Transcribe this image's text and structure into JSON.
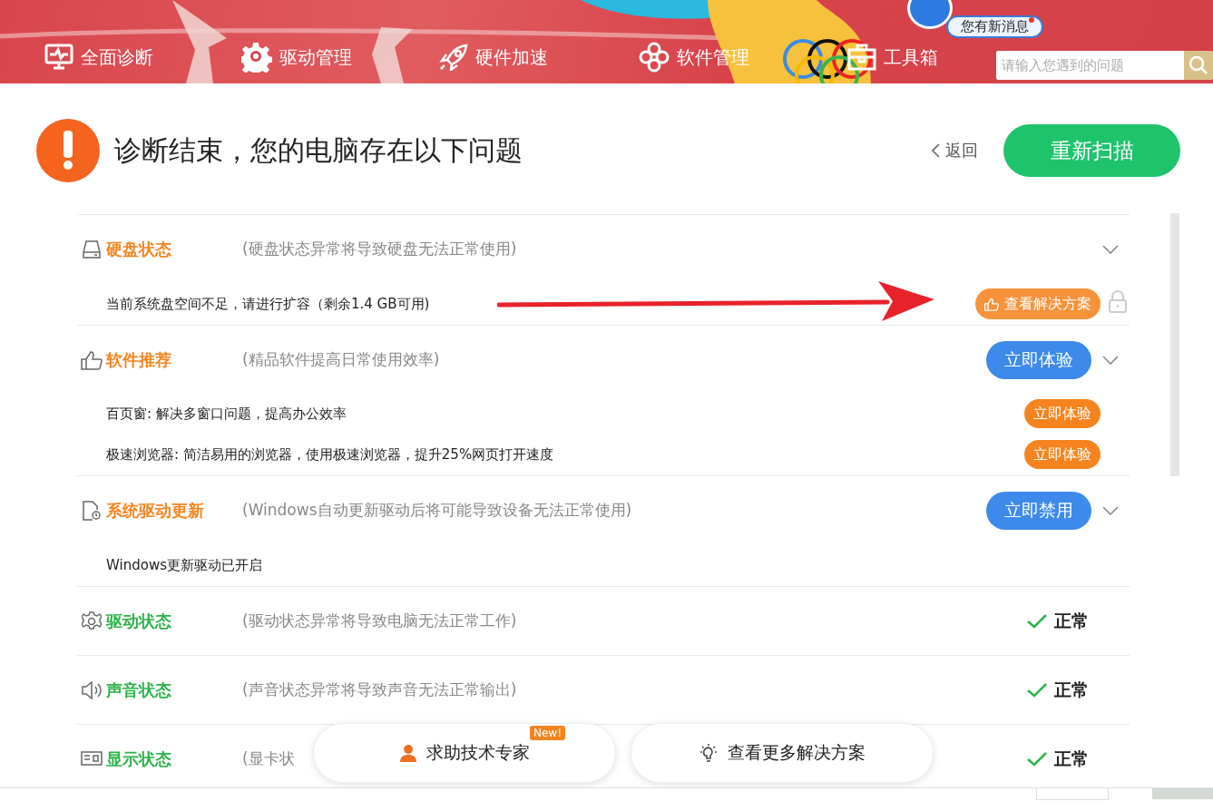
{
  "nav": [
    {
      "label": "全面诊断"
    },
    {
      "label": "驱动管理"
    },
    {
      "label": "硬件加速"
    },
    {
      "label": "软件管理"
    },
    {
      "label": "工具箱"
    }
  ],
  "notification": {
    "text": "您有新消息",
    "unread": true
  },
  "search": {
    "placeholder": "请输入您遇到的问题"
  },
  "result": {
    "title": "诊断结束，您的电脑存在以下问题",
    "back": "返回",
    "rescan": "重新扫描"
  },
  "sections": [
    {
      "kind": "issue",
      "title": "硬盘状态",
      "hint": "(硬盘状态异常将导致硬盘无法正常使用)",
      "expanded": true,
      "details": [
        {
          "kind": "solution",
          "text": "当前系统盘空间不足，请进行扩容（剩余1.4 GB可用)",
          "action": "查看解决方案",
          "locked": true
        }
      ]
    },
    {
      "kind": "issue",
      "title": "软件推荐",
      "hint": "(精品软件提高日常使用效率)",
      "action": "立即体验",
      "expanded": true,
      "details": [
        {
          "kind": "try",
          "text": "百页窗: 解决多窗口问题，提高办公效率",
          "action": "立即体验"
        },
        {
          "kind": "try",
          "text": "极速浏览器:  简洁易用的浏览器，使用极速浏览器，提升25%网页打开速度",
          "action": "立即体验"
        }
      ]
    },
    {
      "kind": "issue",
      "title": "系统驱动更新",
      "hint": "(Windows自动更新驱动后将可能导致设备无法正常使用)",
      "action": "立即禁用",
      "expanded": true,
      "details": [
        {
          "kind": "text",
          "text": "Windows更新驱动已开启"
        }
      ]
    },
    {
      "kind": "ok",
      "title": "驱动状态",
      "hint": "(驱动状态异常将导致电脑无法正常工作)",
      "result": "正常"
    },
    {
      "kind": "ok",
      "title": "声音状态",
      "hint": "(声音状态异常将导致声音无法正常输出)",
      "result": "正常"
    },
    {
      "kind": "ok",
      "title": "显示状态",
      "hint": "(显卡状",
      "result": "正常"
    }
  ],
  "floating": [
    {
      "label": "求助技术专家",
      "badge": "New!"
    },
    {
      "label": "查看更多解决方案"
    }
  ]
}
